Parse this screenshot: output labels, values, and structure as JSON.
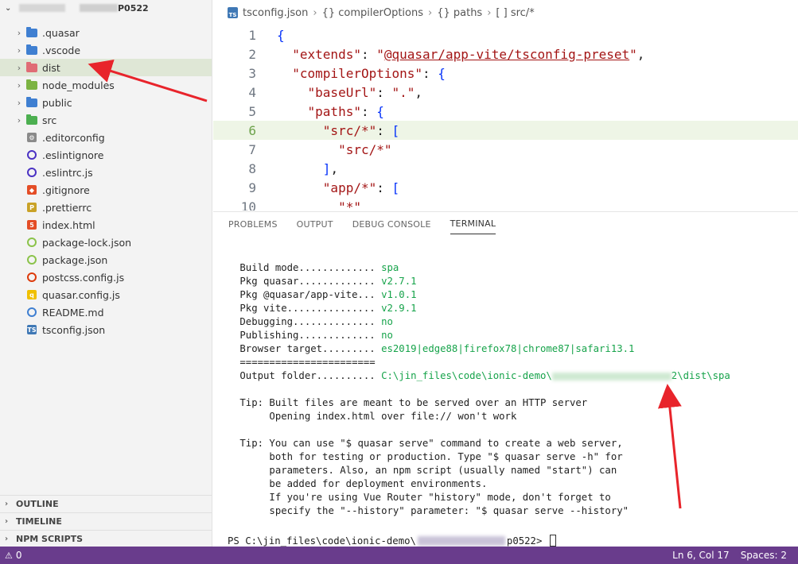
{
  "explorer": {
    "root_label": "P0522",
    "items": [
      {
        "label": ".quasar",
        "type": "folder",
        "color": "#3f7fd1"
      },
      {
        "label": ".vscode",
        "type": "folder",
        "color": "#3f7fd1"
      },
      {
        "label": "dist",
        "type": "folder",
        "color": "#e06c75",
        "selected": true
      },
      {
        "label": "node_modules",
        "type": "folder",
        "color": "#7cb342"
      },
      {
        "label": "public",
        "type": "folder",
        "color": "#3f7fd1"
      },
      {
        "label": "src",
        "type": "folder",
        "color": "#4caf50"
      },
      {
        "label": ".editorconfig",
        "type": "file",
        "icon": "gear-icon"
      },
      {
        "label": ".eslintignore",
        "type": "file",
        "icon": "eslint-icon"
      },
      {
        "label": ".eslintrc.js",
        "type": "file",
        "icon": "eslint-icon"
      },
      {
        "label": ".gitignore",
        "type": "file",
        "icon": "git-icon"
      },
      {
        "label": ".prettierrc",
        "type": "file",
        "icon": "prettier-icon"
      },
      {
        "label": "index.html",
        "type": "file",
        "icon": "html-icon"
      },
      {
        "label": "package-lock.json",
        "type": "file",
        "icon": "npm-icon"
      },
      {
        "label": "package.json",
        "type": "file",
        "icon": "npm-icon"
      },
      {
        "label": "postcss.config.js",
        "type": "file",
        "icon": "postcss-icon"
      },
      {
        "label": "quasar.config.js",
        "type": "file",
        "icon": "js-icon"
      },
      {
        "label": "README.md",
        "type": "file",
        "icon": "info-icon"
      },
      {
        "label": "tsconfig.json",
        "type": "file",
        "icon": "ts-icon"
      }
    ],
    "panels": [
      "OUTLINE",
      "TIMELINE",
      "NPM SCRIPTS"
    ]
  },
  "breadcrumb": {
    "file": "tsconfig.json",
    "parts": [
      "{} compilerOptions",
      "{} paths",
      "[ ] src/*"
    ]
  },
  "code": {
    "lines": [
      {
        "n": "1",
        "segments": [
          {
            "t": "{",
            "c": "b"
          }
        ]
      },
      {
        "n": "2",
        "segments": [
          {
            "t": "  ",
            "c": "p"
          },
          {
            "t": "\"extends\"",
            "c": "k"
          },
          {
            "t": ": ",
            "c": "p"
          },
          {
            "t": "\"",
            "c": "s"
          },
          {
            "t": "@quasar/app-vite/tsconfig-preset",
            "c": "s u"
          },
          {
            "t": "\"",
            "c": "s"
          },
          {
            "t": ",",
            "c": "p"
          }
        ]
      },
      {
        "n": "3",
        "segments": [
          {
            "t": "  ",
            "c": "p"
          },
          {
            "t": "\"compilerOptions\"",
            "c": "k"
          },
          {
            "t": ": ",
            "c": "p"
          },
          {
            "t": "{",
            "c": "b"
          }
        ]
      },
      {
        "n": "4",
        "segments": [
          {
            "t": "    ",
            "c": "p"
          },
          {
            "t": "\"baseUrl\"",
            "c": "k"
          },
          {
            "t": ": ",
            "c": "p"
          },
          {
            "t": "\".\"",
            "c": "s"
          },
          {
            "t": ",",
            "c": "p"
          }
        ]
      },
      {
        "n": "5",
        "segments": [
          {
            "t": "    ",
            "c": "p"
          },
          {
            "t": "\"paths\"",
            "c": "k"
          },
          {
            "t": ": ",
            "c": "p"
          },
          {
            "t": "{",
            "c": "b"
          }
        ]
      },
      {
        "n": "6",
        "segments": [
          {
            "t": "      ",
            "c": "p"
          },
          {
            "t": "\"src/*\"",
            "c": "k"
          },
          {
            "t": ": ",
            "c": "p"
          },
          {
            "t": "[",
            "c": "b"
          }
        ],
        "active": true
      },
      {
        "n": "7",
        "segments": [
          {
            "t": "        ",
            "c": "p"
          },
          {
            "t": "\"src/*\"",
            "c": "s"
          }
        ]
      },
      {
        "n": "8",
        "segments": [
          {
            "t": "      ",
            "c": "p"
          },
          {
            "t": "]",
            "c": "b"
          },
          {
            "t": ",",
            "c": "p"
          }
        ]
      },
      {
        "n": "9",
        "segments": [
          {
            "t": "      ",
            "c": "p"
          },
          {
            "t": "\"app/*\"",
            "c": "k"
          },
          {
            "t": ": ",
            "c": "p"
          },
          {
            "t": "[",
            "c": "b"
          }
        ]
      },
      {
        "n": "10",
        "segments": [
          {
            "t": "        ",
            "c": "p"
          },
          {
            "t": "\"*\"",
            "c": "s"
          }
        ]
      }
    ]
  },
  "panel_tabs": [
    "PROBLEMS",
    "OUTPUT",
    "DEBUG CONSOLE",
    "TERMINAL"
  ],
  "active_tab": "TERMINAL",
  "terminal": {
    "lines": [
      {
        "k": " Build mode............. ",
        "v": "spa"
      },
      {
        "k": " Pkg quasar............. ",
        "v": "v2.7.1"
      },
      {
        "k": " Pkg @quasar/app-vite... ",
        "v": "v1.0.1"
      },
      {
        "k": " Pkg vite............... ",
        "v": "v2.9.1"
      },
      {
        "k": " Debugging.............. ",
        "v": "no"
      },
      {
        "k": " Publishing............. ",
        "v": "no"
      },
      {
        "k": " Browser target......... ",
        "v": "es2019|edge88|firefox78|chrome87|safari13.1"
      },
      {
        "k": " =======================",
        "v": ""
      },
      {
        "k": " Output folder.......... ",
        "v": "C:\\jin_files\\code\\ionic-demo\\",
        "v2": "2\\dist\\spa"
      },
      {
        "k": "",
        "v": ""
      },
      {
        "k": " Tip: Built files are meant to be served over an HTTP server",
        "v": ""
      },
      {
        "k": "      Opening index.html over file:// won't work",
        "v": ""
      },
      {
        "k": "",
        "v": ""
      },
      {
        "k": " Tip: You can use \"$ quasar serve\" command to create a web server,",
        "v": ""
      },
      {
        "k": "      both for testing or production. Type \"$ quasar serve -h\" for",
        "v": ""
      },
      {
        "k": "      parameters. Also, an npm script (usually named \"start\") can",
        "v": ""
      },
      {
        "k": "      be added for deployment environments.",
        "v": ""
      },
      {
        "k": "      If you're using Vue Router \"history\" mode, don't forget to",
        "v": ""
      },
      {
        "k": "      specify the \"--history\" parameter: \"$ quasar serve --history\"",
        "v": ""
      }
    ],
    "prompt_prefix": "PS C:\\jin_files\\code\\ionic-demo\\",
    "prompt_suffix": "p0522> "
  },
  "status": {
    "errors": "0",
    "position": "Ln 6, Col 17",
    "spaces": "Spaces: 2"
  },
  "colors": {
    "status_bar": "#693c8c",
    "annotation_arrow": "#e8242b",
    "terminal_value": "#16a34a"
  }
}
